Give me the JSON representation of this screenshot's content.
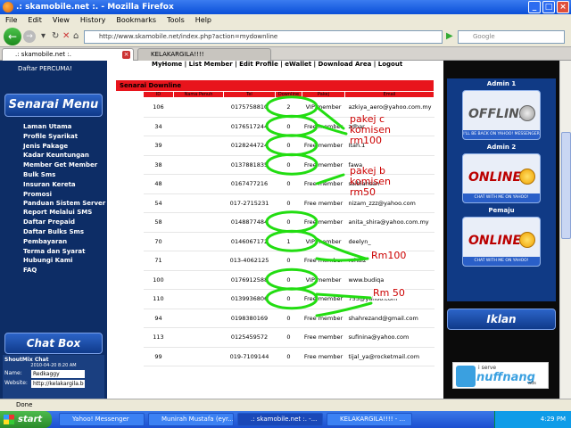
{
  "window": {
    "title": ".: skamobile.net :. - Mozilla Firefox",
    "min": "_",
    "max": "□",
    "close": "×"
  },
  "menu": [
    "File",
    "Edit",
    "View",
    "History",
    "Bookmarks",
    "Tools",
    "Help"
  ],
  "nav": {
    "url": "http://www.skamobile.net/index.php?action=mydownline",
    "search_placeholder": "Google"
  },
  "tabs": [
    {
      "label": ".: skamobile.net :.",
      "active": true
    },
    {
      "label": "KELAKARGILA!!!!",
      "active": false
    }
  ],
  "sidebar": {
    "daftar": "Daftar PERCUMA!",
    "menu_title": "Senarai Menu",
    "items": [
      "Laman Utama",
      "Profile Syarikat",
      "Jenis Pakage",
      "Kadar Keuntungan",
      "Member Get Member",
      "Bulk Sms",
      "Insuran Kereta",
      "Promosi",
      "Panduan Sistem Server",
      "Report Melalui SMS",
      "Daftar Prepaid",
      "Daftar Bulks Sms",
      "Pembayaran",
      "Terma dan Syarat",
      "Hubungi Kami",
      "FAQ"
    ],
    "chat_title": "Chat Box",
    "shout_title": "ShoutMix Chat",
    "shout_time": "2010-04-20 8:20 AM",
    "name_label": "Name:",
    "name_value": "Redkaggy",
    "website_label": "Website:",
    "website_value": "http://kelakargila.b"
  },
  "main": {
    "topnav": "MyHome | List Member | Edit Profile | eWallet | Download Area | Logout",
    "section_title": "Senarai Downline",
    "columns": [
      "ID",
      "Nama Penuh",
      "Tel",
      "Downline",
      "Pakej",
      "Email"
    ],
    "rows": [
      {
        "id": "106",
        "tel": "0175758810",
        "downline": "2",
        "pakej": "VIP member",
        "email": "azkiya_aero@yahoo.com.my"
      },
      {
        "id": "34",
        "tel": "0176517244",
        "downline": "0",
        "pakej": "Free member",
        "email": "zdhar"
      },
      {
        "id": "39",
        "tel": "0128244724",
        "downline": "0",
        "pakej": "Free member",
        "email": "Itah.1"
      },
      {
        "id": "38",
        "tel": "0137881835",
        "downline": "0",
        "pakej": "Free member",
        "email": "fawa"
      },
      {
        "id": "48",
        "tel": "0167477216",
        "downline": "0",
        "pakej": "Free member",
        "email": "salbiahsan"
      },
      {
        "id": "54",
        "tel": "017-2715231",
        "downline": "0",
        "pakej": "Free member",
        "email": "nizam_zzz@yahoo.com"
      },
      {
        "id": "58",
        "tel": "0148877484",
        "downline": "0",
        "pakej": "Free member",
        "email": "anita_shira@yahoo.com.my"
      },
      {
        "id": "70",
        "tel": "0146067172",
        "downline": "1",
        "pakej": "VIP member",
        "email": "deelyn_"
      },
      {
        "id": "71",
        "tel": "013-4062125",
        "downline": "0",
        "pakej": "Free member",
        "email": "rohaiz"
      },
      {
        "id": "100",
        "tel": "0176912588",
        "downline": "0",
        "pakej": "VIP member",
        "email": "www.budiqa"
      },
      {
        "id": "110",
        "tel": "0139936806",
        "downline": "0",
        "pakej": "Free member",
        "email": "755@yahoo.com"
      },
      {
        "id": "94",
        "tel": "0198380169",
        "downline": "0",
        "pakej": "Free member",
        "email": "shahrezand@gmail.com"
      },
      {
        "id": "113",
        "tel": "0125459572",
        "downline": "0",
        "pakej": "Free member",
        "email": "sufinina@yahoo.com"
      },
      {
        "id": "99",
        "tel": "019-7109144",
        "downline": "0",
        "pakej": "Free member",
        "email": "tijal_ya@rocketmail.com"
      }
    ],
    "annotations": [
      "pakej c komisen rm100",
      "pakej b komisen rm50",
      "Rm100",
      "Rm 50"
    ],
    "annotation_color": "#cc0000",
    "scribble_color": "#22dd11"
  },
  "rightside": {
    "admin1": "Admin 1",
    "admin1_status": "OFFLINE",
    "admin1_sub": "I'LL BE BACK ON YAHOO! MESSENGER",
    "admin2": "Admin 2",
    "admin2_status": "ONLINE",
    "admin2_sub": "CHAT WITH ME ON YAHOO! MESSENGER",
    "pemaju": "Pemaju",
    "pemaju_status": "ONLINE",
    "pemaju_sub": "CHAT WITH ME ON YAHOO! MESSENGER",
    "iklan": "Iklan",
    "nuff_top": "i serve",
    "nuff_brand": "nuffnang",
    "nuff_ads": "ads"
  },
  "status": "Done",
  "taskbar": {
    "start": "start",
    "tasks": [
      "Yahoo! Messenger",
      "Munirah Mustafa (eyr...",
      ".: skamobile.net :. -...",
      "KELAKARGILA!!!! - ..."
    ],
    "time": "4:29 PM"
  }
}
